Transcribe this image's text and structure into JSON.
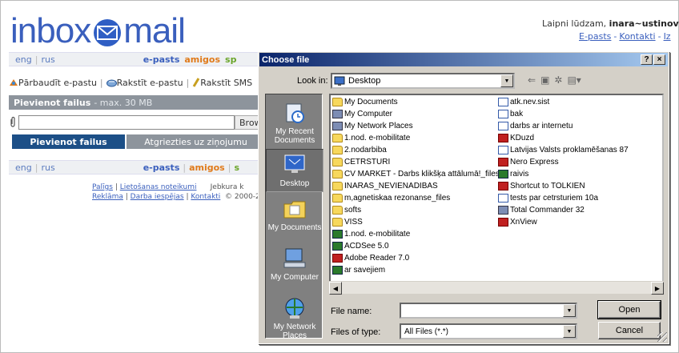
{
  "header": {
    "logo_part1": "inbox",
    "logo_part2": "mail",
    "welcome_text": "Laipni lūdzam,",
    "username": "inara~ustinova",
    "links": [
      "E-pasts",
      "Kontakti",
      "Iz"
    ]
  },
  "nav": {
    "langs": [
      "eng",
      "rus"
    ],
    "links": [
      "e-pasts",
      "amigos",
      "sp"
    ]
  },
  "toolbar": {
    "items": [
      "Pārbaudīt e-pastu",
      "Rakstīt e-pastu",
      "Rakstīt SMS"
    ]
  },
  "attach": {
    "title": "Pievienot failus",
    "subtitle": "- max. 30 MB",
    "browse_label": "Brow",
    "file_value": "",
    "tab_add": "Pievienot failus",
    "tab_back": "Atgriezties uz ziņojumu"
  },
  "nav_bottom": {
    "langs": [
      "eng",
      "rus"
    ],
    "links": [
      "e-pasts",
      "amigos",
      "s"
    ]
  },
  "footer": {
    "row1_links": [
      "Palīgs",
      "Lietošanas noteikumi"
    ],
    "row1_text": "Jebkura k",
    "row2_links": [
      "Reklāma",
      "Darba iespējas",
      "Kontakti"
    ],
    "row2_text": "© 2000-2("
  },
  "dialog": {
    "title": "Choose file",
    "help_label": "?",
    "close_label": "×",
    "look_in_label": "Look in:",
    "look_in_value": "Desktop",
    "places": [
      "My Recent Documents",
      "Desktop",
      "My Documents",
      "My Computer",
      "My Network Places"
    ],
    "files_col1": [
      {
        "name": "My Documents",
        "icon": "folder-icon"
      },
      {
        "name": "My Computer",
        "icon": "computer-icon"
      },
      {
        "name": "My Network Places",
        "icon": "network-icon"
      },
      {
        "name": "1.nod. e-mobilitate",
        "icon": "folder-icon"
      },
      {
        "name": "2.nodarbiba",
        "icon": "folder-icon"
      },
      {
        "name": "CETRSTURI",
        "icon": "folder-icon"
      },
      {
        "name": "CV MARKET - Darbs klikšķa attālumā!_files",
        "icon": "folder-icon"
      },
      {
        "name": "INARAS_NEVIENADIBAS",
        "icon": "folder-icon"
      },
      {
        "name": "m,agnetiskaa rezonanse_files",
        "icon": "folder-icon"
      },
      {
        "name": "softs",
        "icon": "folder-icon"
      },
      {
        "name": "VISS",
        "icon": "folder-icon"
      },
      {
        "name": "1.nod. e-mobilitate",
        "icon": "archive-icon"
      },
      {
        "name": "ACDSee 5.0",
        "icon": "app-icon"
      },
      {
        "name": "Adobe Reader 7.0",
        "icon": "pdf-icon"
      },
      {
        "name": "ar savejiem",
        "icon": "archive-icon"
      }
    ],
    "files_col2": [
      {
        "name": "atk.nev.sist",
        "icon": "doc-icon"
      },
      {
        "name": "bak",
        "icon": "doc-icon"
      },
      {
        "name": "darbs ar internetu",
        "icon": "doc-icon"
      },
      {
        "name": "KDuzd",
        "icon": "image-icon"
      },
      {
        "name": "Latvijas Valsts proklamēšanas 87",
        "icon": "doc-icon"
      },
      {
        "name": "Nero Express",
        "icon": "app-icon"
      },
      {
        "name": "raivis",
        "icon": "archive-icon"
      },
      {
        "name": "Shortcut to TOLKIEN",
        "icon": "shortcut-icon"
      },
      {
        "name": "tests par cetrsturiem 10a",
        "icon": "doc-icon"
      },
      {
        "name": "Total Commander 32",
        "icon": "app-icon"
      },
      {
        "name": "XnView",
        "icon": "app-icon"
      }
    ],
    "file_name_label": "File name:",
    "file_name_value": "",
    "files_of_type_label": "Files of type:",
    "files_of_type_value": "All Files (*.*)",
    "open_label": "Open",
    "cancel_label": "Cancel"
  }
}
